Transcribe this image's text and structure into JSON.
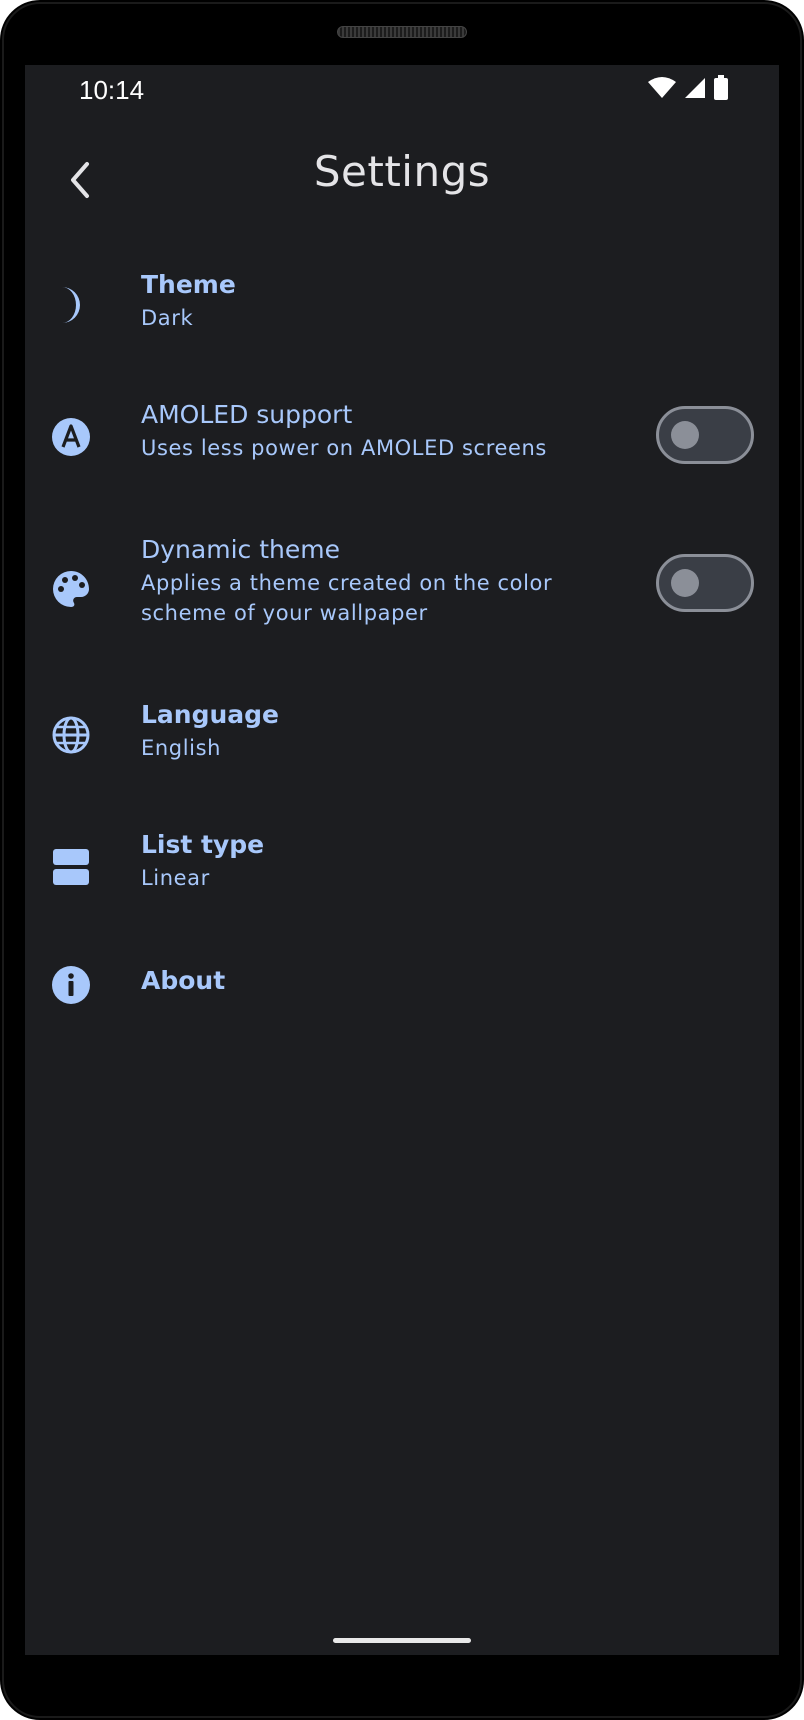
{
  "status_bar": {
    "time": "10:14",
    "icons": [
      "wifi-icon",
      "signal-icon",
      "battery-icon"
    ]
  },
  "app_bar": {
    "back_icon": "arrow-back-icon",
    "title": "Settings"
  },
  "settings": {
    "items": [
      {
        "id": "theme",
        "icon": "moon-icon",
        "title": "Theme",
        "subtitle": "Dark"
      },
      {
        "id": "amoled",
        "icon": "letter-a-icon",
        "title": "AMOLED support",
        "subtitle": "Uses less power on AMOLED screens",
        "toggle": false
      },
      {
        "id": "dynamic",
        "icon": "palette-icon",
        "title": "Dynamic theme",
        "subtitle_line1": "Applies a theme created on the color",
        "subtitle_line2": "scheme of your wallpaper",
        "toggle": false
      },
      {
        "id": "language",
        "icon": "globe-icon",
        "title": "Language",
        "subtitle": "English"
      },
      {
        "id": "list_type",
        "icon": "view-agenda-icon",
        "title": "List type",
        "subtitle": "Linear"
      },
      {
        "id": "about",
        "icon": "info-icon",
        "title": "About"
      }
    ]
  },
  "colors": {
    "background": "#1c1d20",
    "accent": "#a8c8fb",
    "title_text": "#e4e4e7",
    "toggle_track": "#3a3e46",
    "toggle_outline": "#8b8f98"
  }
}
